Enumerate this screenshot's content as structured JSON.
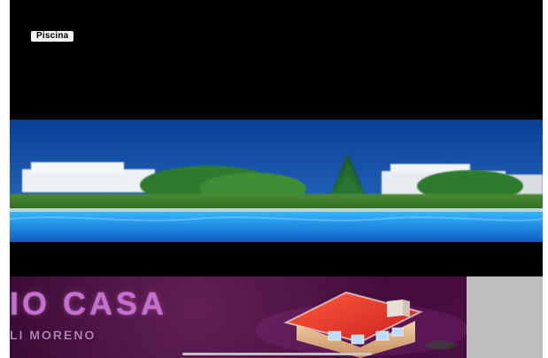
{
  "page": {
    "chip_label": "Piscina",
    "banner": {
      "title": "IO CASA",
      "subtitle": "LI MORENO"
    }
  },
  "colors": {
    "background": "#000000",
    "chip_bg": "#f4f4f4",
    "banner_bg": "#3b0b34",
    "banner_text": "#c86ed1",
    "side_panel": "#bdbdbd"
  },
  "icons": {
    "home_indicator": "home-indicator-bar",
    "house_illustration": "house-illustration"
  }
}
